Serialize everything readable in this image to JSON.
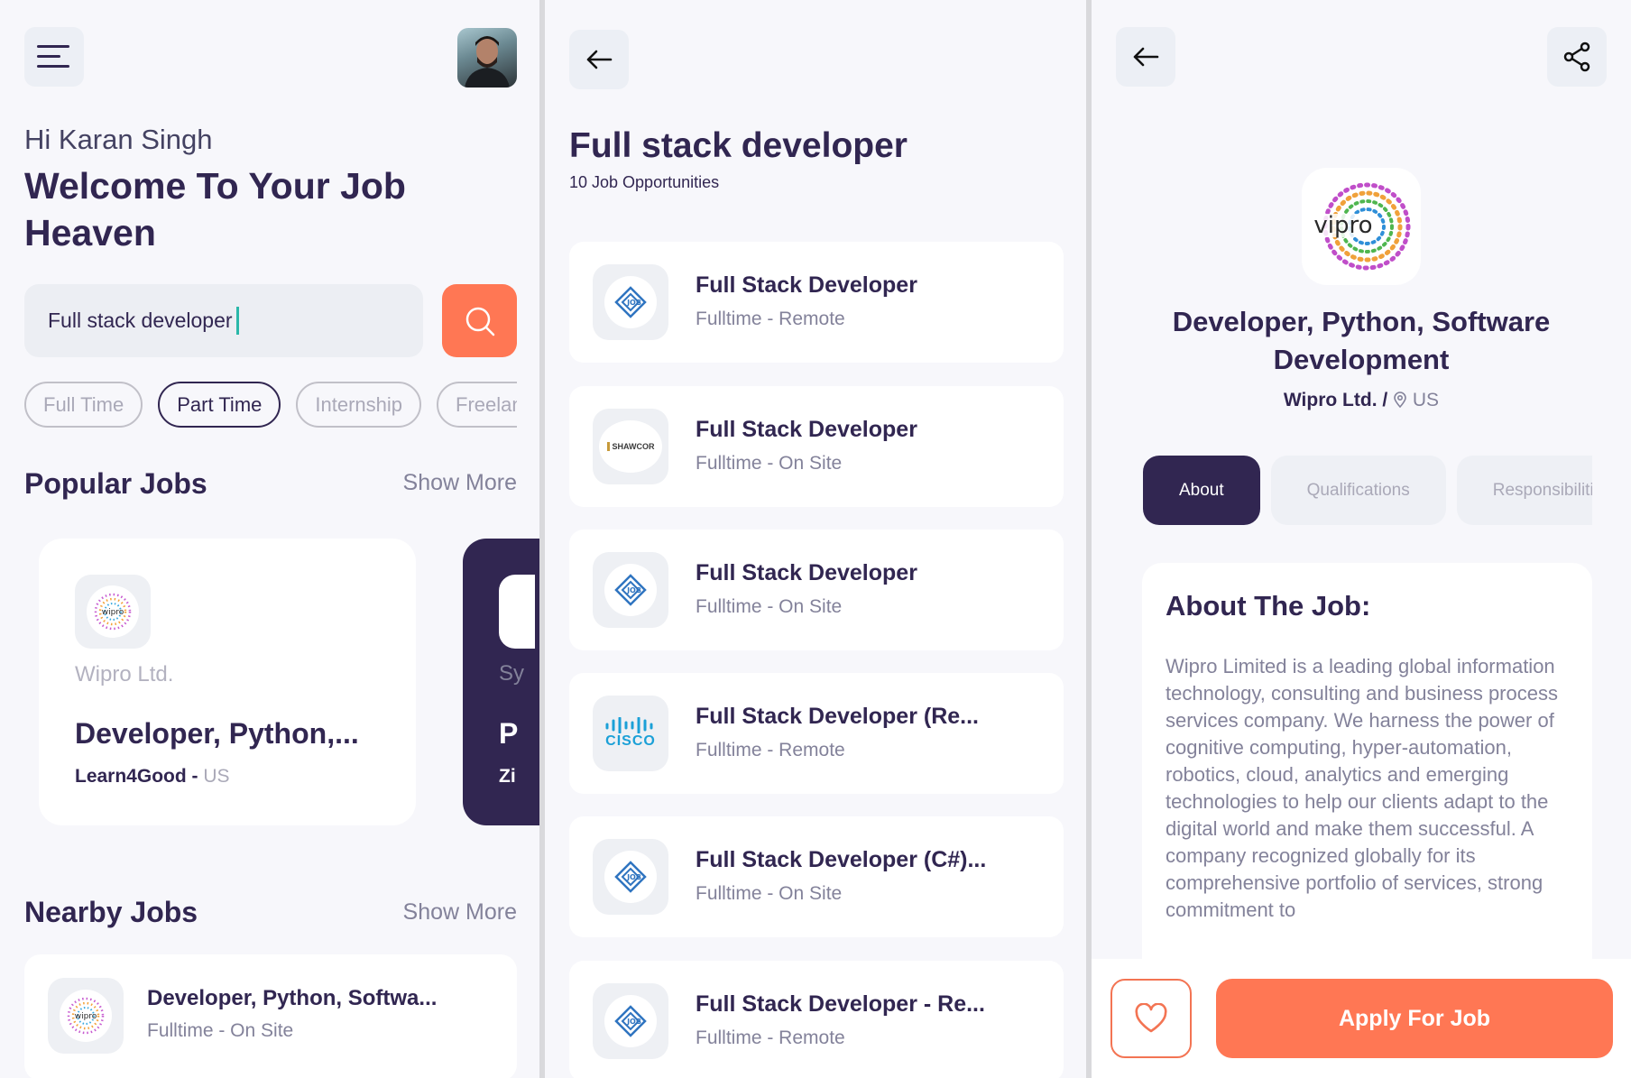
{
  "home": {
    "greeting": "Hi Karan Singh",
    "welcome": "Welcome To Your Job Heaven",
    "search_value": "Full stack developer",
    "job_types": [
      "Full Time",
      "Part Time",
      "Internship",
      "Freelance"
    ],
    "active_job_type": "Part Time",
    "popular_title": "Popular Jobs",
    "popular_show_more": "Show More",
    "popular_jobs": [
      {
        "logo": "wipro",
        "company": "Wipro Ltd.",
        "title": "Developer, Python,...",
        "publisher": "Learn4Good -",
        "location": "US"
      },
      {
        "company": "Sy",
        "title": "P",
        "publisher": "Zi"
      }
    ],
    "nearby_title": "Nearby Jobs",
    "nearby_show_more": "Show More",
    "nearby_jobs": [
      {
        "logo": "wipro",
        "title": "Developer, Python, Softwa...",
        "subtitle": "Fulltime - On Site"
      }
    ]
  },
  "results": {
    "title": "Full stack developer",
    "count_text": "10 Job Opportunities",
    "jobs": [
      {
        "logo": "job-icon",
        "title": "Full Stack Developer",
        "subtitle": "Fulltime - Remote"
      },
      {
        "logo": "shawcor",
        "logo_text": "SHAWCOR",
        "title": "Full Stack Developer",
        "subtitle": "Fulltime - On Site"
      },
      {
        "logo": "job-icon",
        "title": "Full Stack Developer",
        "subtitle": "Fulltime - On Site"
      },
      {
        "logo": "cisco",
        "logo_text": "CISCO",
        "title": "Full Stack Developer (Re...",
        "subtitle": "Fulltime - Remote"
      },
      {
        "logo": "job-icon",
        "title": "Full Stack Developer (C#)...",
        "subtitle": "Fulltime - On Site"
      },
      {
        "logo": "job-icon",
        "title": "Full Stack Developer - Re...",
        "subtitle": "Fulltime - Remote"
      }
    ]
  },
  "details": {
    "logo_text": "vipro",
    "title": "Developer, Python, Software Development",
    "company": "Wipro Ltd. /",
    "location": "US",
    "tabs": [
      "About",
      "Qualifications",
      "Responsibilities"
    ],
    "active_tab": "About",
    "about_heading": "About The Job:",
    "about_text": "Wipro Limited is a leading global information technology, consulting and business process services company. We harness the power of cognitive computing, hyper-automation, robotics, cloud, analytics and emerging technologies to help our clients adapt to the digital world and make them successful. A company recognized globally for its comprehensive portfolio of services, strong commitment to",
    "apply_label": "Apply For Job"
  },
  "colors": {
    "primary": "#312651",
    "accent": "#ff7754",
    "gray": "#83829a",
    "background": "#f7f7fb"
  },
  "icons": [
    "menu-icon",
    "avatar",
    "search-icon",
    "back-arrow-icon",
    "share-icon",
    "location-pin-icon",
    "heart-icon"
  ]
}
